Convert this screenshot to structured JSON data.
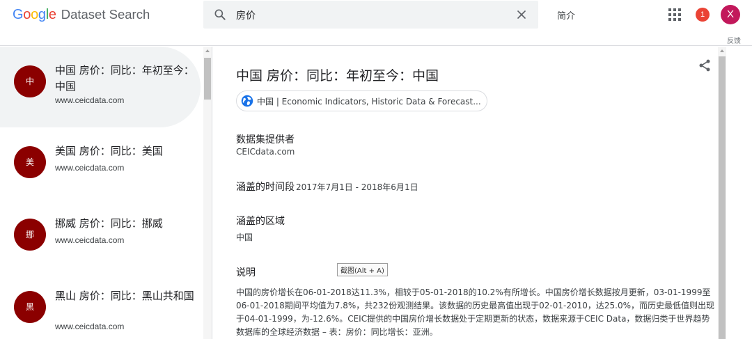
{
  "header": {
    "logo_letters": [
      {
        "char": "G",
        "color": "#4285f4"
      },
      {
        "char": "o",
        "color": "#ea4335"
      },
      {
        "char": "o",
        "color": "#fbbc05"
      },
      {
        "char": "g",
        "color": "#4285f4"
      },
      {
        "char": "l",
        "color": "#34a853"
      },
      {
        "char": "e",
        "color": "#ea4335"
      }
    ],
    "product_name": "Dataset Search",
    "search_query": "房价",
    "about_label": "简介",
    "notification_count": "1",
    "avatar_initial": "X",
    "feedback_label": "反馈",
    "icons": {
      "search": "search-icon",
      "clear": "close-icon",
      "apps": "apps-grid-icon"
    }
  },
  "results": [
    {
      "badge": "中",
      "title": "中国 房价：同比：年初至今：中国",
      "domain": "www.ceicdata.com",
      "active": true
    },
    {
      "badge": "美",
      "title": "美国 房价：同比：美国",
      "domain": "www.ceicdata.com",
      "active": false
    },
    {
      "badge": "挪",
      "title": "挪威 房价：同比：挪威",
      "domain": "www.ceicdata.com",
      "active": false
    },
    {
      "badge": "黑",
      "title": "黑山 房价：同比：黑山共和国",
      "domain": "www.ceicdata.com",
      "active": false
    }
  ],
  "detail": {
    "title": "中国 房价：同比：年初至今：中国",
    "source_chip": "中国 | Economic Indicators, Historic Data & Forecast...",
    "provider_label": "数据集提供者",
    "provider_value": "CEICdata.com",
    "period_label": "涵盖的时间段",
    "period_value": "2017年7月1日 - 2018年6月1日",
    "region_label": "涵盖的区域",
    "region_value": "中国",
    "desc_label": "说明",
    "description": "中国的房价增长在06-01-2018达11.3%，相较于05-01-2018的10.2%有所增长。中国房价增长数据按月更新，03-01-1999至06-01-2018期间平均值为7.8%，共232份观测结果。该数据的历史最高值出现于02-01-2010，达25.0%，而历史最低值则出现于04-01-1999，为-12.6%。CEIC提供的中国房价增长数据处于定期更新的状态，数据来源于CEIC Data，数据归类于世界趋势数据库的全球经济数据 – 表：房价：同比增长：亚洲。",
    "icons": {
      "share": "share-icon",
      "globe": "globe-icon"
    }
  },
  "tooltip": "截图(Alt + A)",
  "colors": {
    "badge": "#8b0000",
    "avatar": "#c2185b",
    "notification": "#ea4335",
    "active_item": "#f1f3f4"
  }
}
